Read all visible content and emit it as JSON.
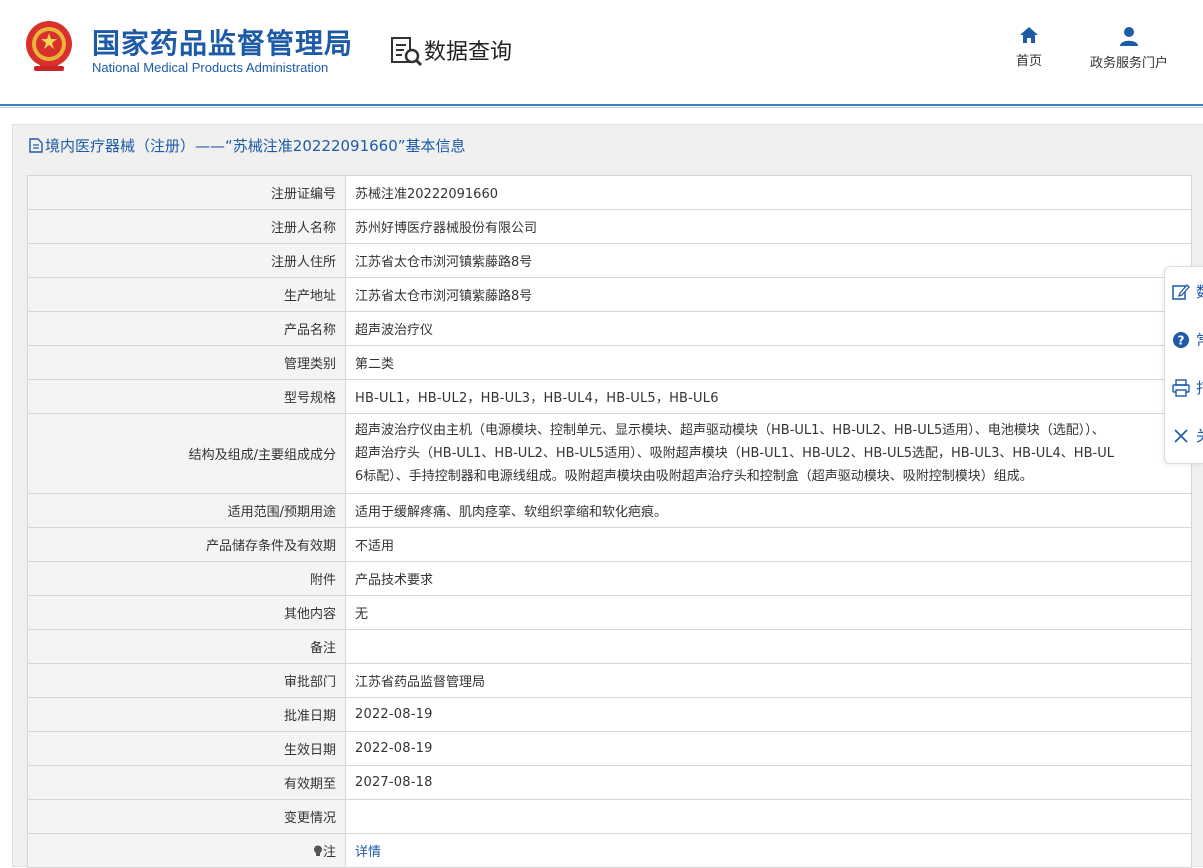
{
  "header": {
    "org_name_cn": "国家药品监督管理局",
    "org_name_en": "National Medical Products Administration",
    "query_title": "数据查询",
    "nav": {
      "home_label": "首页",
      "portal_label": "政务服务门户"
    }
  },
  "section": {
    "title": "境内医疗器械（注册）——“苏械注准20222091660”基本信息"
  },
  "rows": [
    {
      "label": "注册证编号",
      "value": "苏械注准20222091660"
    },
    {
      "label": "注册人名称",
      "value": "苏州好博医疗器械股份有限公司"
    },
    {
      "label": "注册人住所",
      "value": "江苏省太仓市浏河镇紫藤路8号"
    },
    {
      "label": "生产地址",
      "value": "江苏省太仓市浏河镇紫藤路8号"
    },
    {
      "label": "产品名称",
      "value": "超声波治疗仪"
    },
    {
      "label": "管理类别",
      "value": "第二类"
    },
    {
      "label": "型号规格",
      "value": "HB-UL1，HB-UL2，HB-UL3，HB-UL4，HB-UL5，HB-UL6"
    },
    {
      "label": "结构及组成/主要组成成分",
      "value_lines": [
        "超声波治疗仪由主机（电源模块、控制单元、显示模块、超声驱动模块（HB-UL1、HB-UL2、HB-UL5适用）、电池模块（选配））、",
        "超声治疗头（HB-UL1、HB-UL2、HB-UL5适用）、吸附超声模块（HB-UL1、HB-UL2、HB-UL5选配，HB-UL3、HB-UL4、HB-UL",
        "6标配）、手持控制器和电源线组成。吸附超声模块由吸附超声治疗头和控制盒（超声驱动模块、吸附控制模块）组成。"
      ]
    },
    {
      "label": "适用范围/预期用途",
      "value": "适用于缓解疼痛、肌肉痉挛、软组织挛缩和软化疤痕。"
    },
    {
      "label": "产品储存条件及有效期",
      "value": "不适用"
    },
    {
      "label": "附件",
      "value": "产品技术要求"
    },
    {
      "label": "其他内容",
      "value": "无"
    },
    {
      "label": "备注",
      "value": ""
    },
    {
      "label": "审批部门",
      "value": "江苏省药品监督管理局"
    },
    {
      "label": "批准日期",
      "value": "2022-08-19"
    },
    {
      "label": "生效日期",
      "value": "2022-08-19"
    },
    {
      "label": "有效期至",
      "value": "2027-08-18"
    },
    {
      "label": "变更情况",
      "value": ""
    },
    {
      "label": "注",
      "value": "详情"
    }
  ],
  "side_panel": {
    "items": [
      "数",
      "常",
      "打",
      "关"
    ]
  },
  "colors": {
    "brand_blue": "#1d5aa8",
    "header_rule": "#3f7fc4",
    "label_bg": "#f4f4f4",
    "border": "#d6d6d6"
  }
}
